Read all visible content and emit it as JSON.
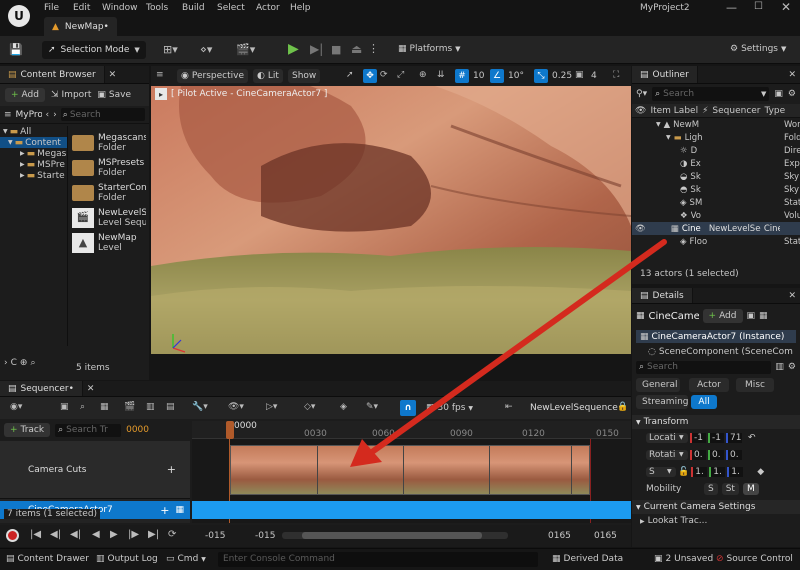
{
  "menu": [
    "File",
    "Edit",
    "Window",
    "Tools",
    "Build",
    "Select",
    "Actor",
    "Help"
  ],
  "project": "MyProject2",
  "map_tab": "NewMap•",
  "toolbar": {
    "mode": "Selection Mode",
    "platforms": "Platforms",
    "settings": "Settings"
  },
  "content_browser": {
    "title": "Content Browser",
    "add": "Add",
    "import": "Import",
    "save": "Save",
    "search_placeholder": "Search",
    "path_root": "MyProj",
    "tree": [
      "All",
      "Content",
      "Megas",
      "MSPre",
      "Starte"
    ],
    "assets": [
      {
        "name": "Megascans",
        "type": "Folder"
      },
      {
        "name": "MSPresets",
        "type": "Folder"
      },
      {
        "name": "StarterCon",
        "type": "Folder"
      },
      {
        "name": "NewLevelS",
        "type": "Level Seque"
      },
      {
        "name": "NewMap",
        "type": "Level"
      }
    ],
    "count": "5 items",
    "collections": "C"
  },
  "viewport": {
    "perspective": "Perspective",
    "lit": "Lit",
    "show": "Show",
    "grid": "10",
    "angle": "10°",
    "scale": "0.25",
    "cams": "4",
    "pilot": "[ Pilot Active - CineCameraActor7 ]"
  },
  "outliner": {
    "title": "Outliner",
    "search_placeholder": "Search",
    "col_label": "Item Label",
    "col_seq": "Sequencer",
    "col_type": "Type",
    "rows": [
      {
        "label": "NewM",
        "seq": "",
        "type": "Wor"
      },
      {
        "label": "Ligh",
        "seq": "",
        "type": "Fold"
      },
      {
        "label": "D",
        "seq": "",
        "type": "Dire"
      },
      {
        "label": "Ex",
        "seq": "",
        "type": "Exp"
      },
      {
        "label": "Sk",
        "seq": "",
        "type": "Sky"
      },
      {
        "label": "Sk",
        "seq": "",
        "type": "Sky"
      },
      {
        "label": "SM",
        "seq": "",
        "type": "Stat"
      },
      {
        "label": "Vo",
        "seq": "",
        "type": "Volu"
      },
      {
        "label": "Cine",
        "seq": "NewLevelSeq",
        "type": "Cine"
      },
      {
        "label": "Floo",
        "seq": "",
        "type": "Stat"
      }
    ],
    "status": "13 actors (1 selected)"
  },
  "details": {
    "title": "Details",
    "name": "CineCame",
    "add": "Add",
    "instance": "CineCameraActor7 (Instance)",
    "component": "SceneComponent (SceneCom",
    "search_placeholder": "Search",
    "filters": [
      "General",
      "Actor",
      "Misc",
      "Streaming",
      "All"
    ],
    "section_transform": "Transform",
    "location": "Locati",
    "rotation": "Rotati",
    "scale": "S",
    "loc_vals": [
      "-1",
      "-1",
      "71"
    ],
    "rot_vals": [
      "0.",
      "0.",
      "0."
    ],
    "scale_vals": [
      "1.",
      "1.",
      "1."
    ],
    "mobility": "Mobility",
    "mob_opts": [
      "S",
      "St",
      "M"
    ],
    "section_camera": "Current Camera Settings",
    "lookat": "Lookat Trac..."
  },
  "sequencer": {
    "title": "Sequencer•",
    "fps": "30 fps",
    "sequence": "NewLevelSequence•",
    "track_btn": "Track",
    "search_placeholder": "Search Tr",
    "frame": "0000",
    "ruler": [
      "0000",
      "0030",
      "0060",
      "0090",
      "0120",
      "0150"
    ],
    "tracks": [
      "Camera Cuts",
      "CineCameraActor7"
    ],
    "selected": "7 items (1 selected)",
    "start": "-015",
    "start2": "-015",
    "end": "0165",
    "end2": "0165"
  },
  "status": {
    "drawer": "Content Drawer",
    "output": "Output Log",
    "cmd": "Cmd",
    "console_placeholder": "Enter Console Command",
    "derived": "Derived Data",
    "unsaved": "2 Unsaved",
    "source": "Source Control"
  },
  "colors": {
    "accent": "#1c9bf0",
    "play": "#6fc24b",
    "arrow": "#d42a1e",
    "selected_row": "#0e78cc"
  }
}
